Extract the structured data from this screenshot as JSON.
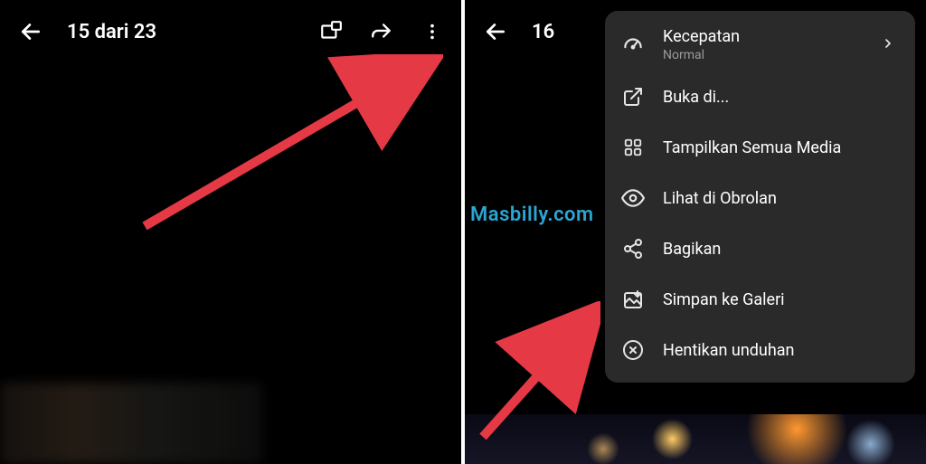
{
  "left": {
    "counter": "15 dari 23"
  },
  "right": {
    "counter": "16",
    "watermark": "Masbilly.com",
    "menu": {
      "speed": {
        "label": "Kecepatan",
        "value": "Normal"
      },
      "open_in": "Buka di...",
      "show_all": "Tampilkan Semua Media",
      "view_chat": "Lihat di Obrolan",
      "share": "Bagikan",
      "save": "Simpan ke Galeri",
      "stop": "Hentikan unduhan"
    }
  },
  "colors": {
    "arrow": "#e53945",
    "watermark": "#2ba6d4"
  }
}
